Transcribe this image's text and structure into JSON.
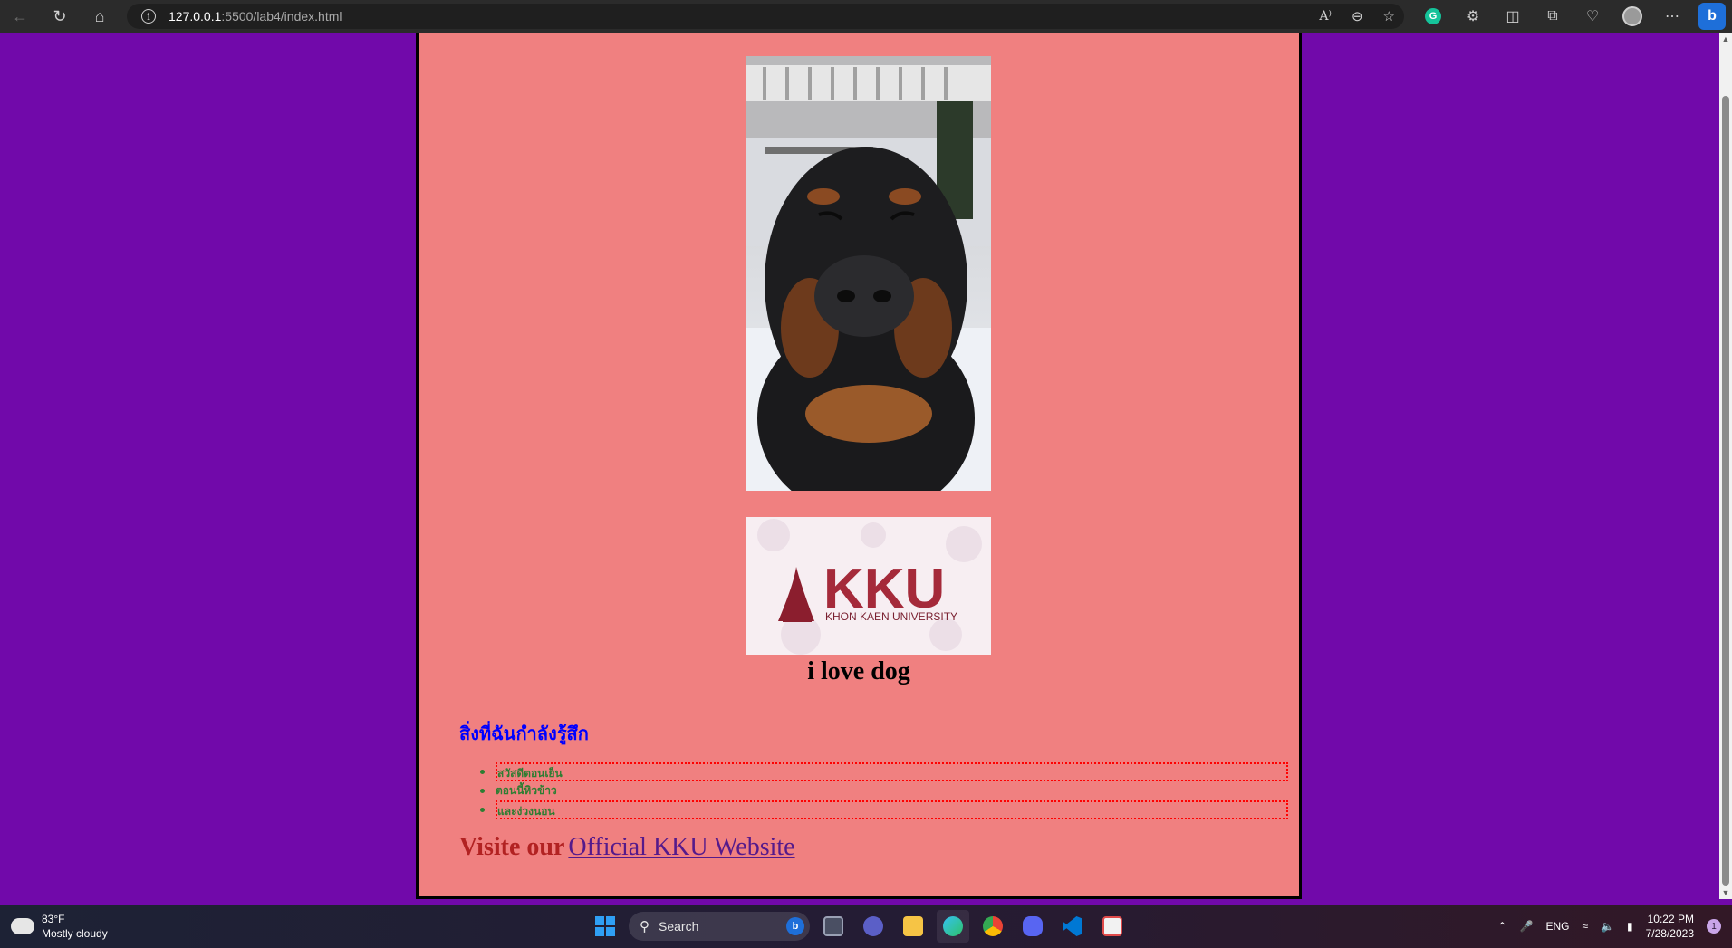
{
  "browser": {
    "url_host": "127.0.0.1",
    "url_path": ":5500/lab4/index.html"
  },
  "page": {
    "heading": "i love dog",
    "section_title": "สิ่งที่ฉันกำลังรู้สึก",
    "feelings": [
      "สวัสดีตอนเย็น",
      "ตอนนี้หิวข้าว",
      "และง่วงนอน"
    ],
    "visit_prefix": "Visite our",
    "visit_link": "Official KKU Website",
    "logo": {
      "brand": "KKU",
      "subtitle": "KHON KAEN UNIVERSITY"
    },
    "colors": {
      "background": "#7109aa",
      "content_background": "#f08080",
      "section_title": "#0000ff",
      "list_text": "#2e7d32",
      "dotted_border": "#ff0000",
      "visit_prefix": "#b22222",
      "link": "#551a8b"
    }
  },
  "taskbar": {
    "weather_temp": "83°F",
    "weather_desc": "Mostly cloudy",
    "search_label": "Search",
    "language": "ENG",
    "time": "10:22 PM",
    "date": "7/28/2023",
    "notification_count": "1",
    "apps": [
      "file-explorer-icon",
      "edge-icon",
      "chrome-icon",
      "discord-icon",
      "vscode-icon",
      "snipping-tool-icon"
    ]
  }
}
